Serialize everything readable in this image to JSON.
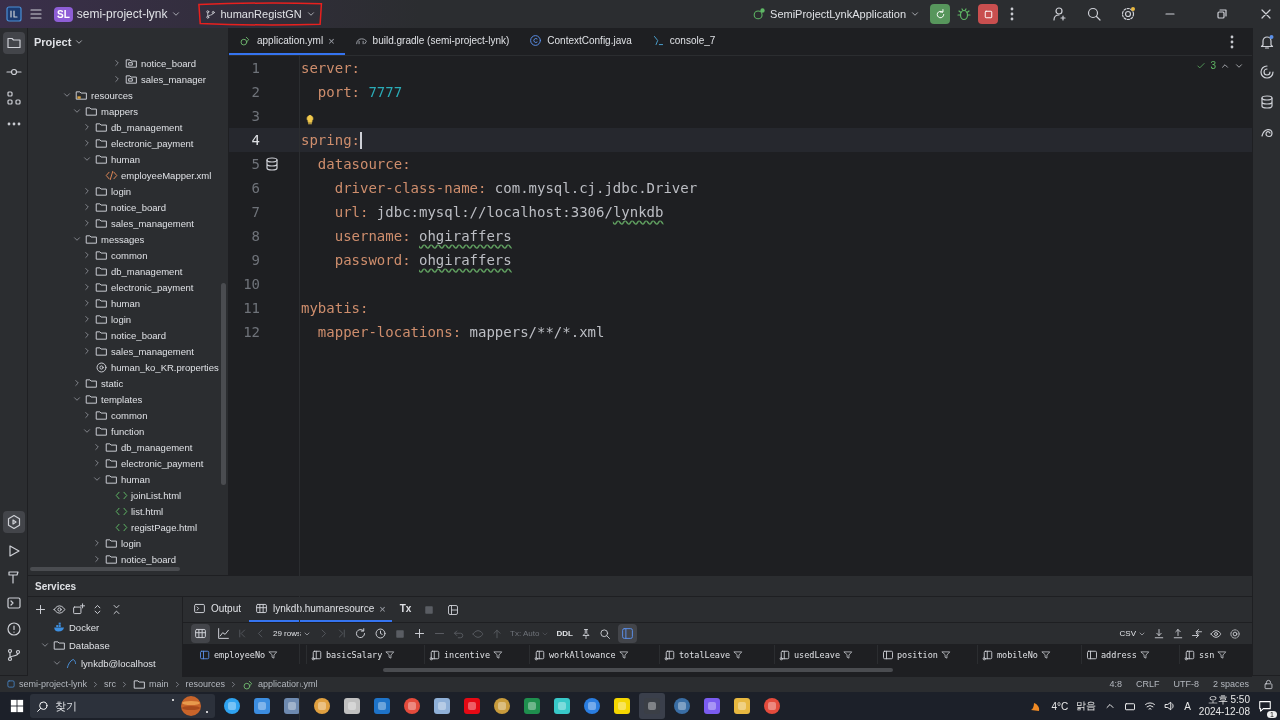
{
  "title_bar": {
    "project_badge": "SL",
    "project": "semi-project-lynk",
    "branch": "humanRegistGN",
    "run_config": "SemiProjectLynkApplication"
  },
  "project_panel": {
    "title": "Project",
    "tree_partial": [
      {
        "label": "notice_board",
        "kind": "package",
        "expanded": false
      },
      {
        "label": "sales_manager",
        "kind": "package",
        "expanded": false
      }
    ],
    "tree": [
      {
        "label": "resources",
        "kind": "resource-root",
        "expanded": true,
        "children": [
          {
            "label": "mappers",
            "kind": "folder",
            "expanded": true,
            "children": [
              {
                "label": "db_management",
                "kind": "folder",
                "expanded": false
              },
              {
                "label": "electronic_payment",
                "kind": "folder",
                "expanded": false
              },
              {
                "label": "human",
                "kind": "folder",
                "expanded": true,
                "children": [
                  {
                    "label": "employeeMapper.xml",
                    "kind": "xml"
                  }
                ]
              },
              {
                "label": "login",
                "kind": "folder",
                "expanded": false
              },
              {
                "label": "notice_board",
                "kind": "folder",
                "expanded": false
              },
              {
                "label": "sales_management",
                "kind": "folder",
                "expanded": false
              }
            ]
          },
          {
            "label": "messages",
            "kind": "folder",
            "expanded": true,
            "children": [
              {
                "label": "common",
                "kind": "folder",
                "expanded": false
              },
              {
                "label": "db_management",
                "kind": "folder",
                "expanded": false
              },
              {
                "label": "electronic_payment",
                "kind": "folder",
                "expanded": false
              },
              {
                "label": "human",
                "kind": "folder",
                "expanded": false
              },
              {
                "label": "login",
                "kind": "folder",
                "expanded": false
              },
              {
                "label": "notice_board",
                "kind": "folder",
                "expanded": false
              },
              {
                "label": "sales_management",
                "kind": "folder",
                "expanded": false
              },
              {
                "label": "human_ko_KR.properties",
                "kind": "properties"
              }
            ]
          },
          {
            "label": "static",
            "kind": "folder",
            "expanded": false
          },
          {
            "label": "templates",
            "kind": "folder",
            "expanded": true,
            "children": [
              {
                "label": "common",
                "kind": "folder",
                "expanded": false
              },
              {
                "label": "function",
                "kind": "folder",
                "expanded": true,
                "children": [
                  {
                    "label": "db_management",
                    "kind": "folder",
                    "expanded": false
                  },
                  {
                    "label": "electronic_payment",
                    "kind": "folder",
                    "expanded": false
                  },
                  {
                    "label": "human",
                    "kind": "folder",
                    "expanded": true,
                    "children": [
                      {
                        "label": "joinList.html",
                        "kind": "html"
                      },
                      {
                        "label": "list.html",
                        "kind": "html"
                      },
                      {
                        "label": "registPage.html",
                        "kind": "html"
                      }
                    ]
                  },
                  {
                    "label": "login",
                    "kind": "folder",
                    "expanded": false
                  },
                  {
                    "label": "notice_board",
                    "kind": "folder",
                    "expanded": false
                  }
                ]
              }
            ]
          }
        ]
      }
    ]
  },
  "editor": {
    "tabs": [
      {
        "label": "application.yml",
        "kind": "yaml",
        "selected": true,
        "close": "×"
      },
      {
        "label": "build.gradle (semi-project-lynk)",
        "kind": "gradle",
        "selected": false
      },
      {
        "label": "ContextConfig.java",
        "kind": "java",
        "selected": false
      },
      {
        "label": "console_7",
        "kind": "console",
        "selected": false
      }
    ],
    "inspection_count": "3",
    "lines": [
      {
        "number": "1",
        "kind": "plain",
        "current": false,
        "segments": [
          {
            "text": "server:",
            "kind": "key"
          }
        ]
      },
      {
        "number": "2",
        "kind": "plain",
        "current": false,
        "segments": [
          {
            "text": "  port:",
            "kind": "key"
          },
          {
            "text": " 7777",
            "kind": "number"
          }
        ]
      },
      {
        "number": "3",
        "kind": "hint",
        "current": false
      },
      {
        "number": "4",
        "kind": "plain",
        "current": true,
        "segments": [
          {
            "text": "spring:",
            "kind": "key"
          }
        ]
      },
      {
        "number": "5",
        "kind": "datasource",
        "current": false,
        "segments": [
          {
            "text": "  datasource:",
            "kind": "key"
          }
        ]
      },
      {
        "number": "6",
        "kind": "plain",
        "current": false,
        "segments": [
          {
            "text": "    driver-class-name:",
            "kind": "key"
          },
          {
            "text": " com.mysql.cj.jdbc.Driver",
            "kind": "value"
          }
        ]
      },
      {
        "number": "7",
        "kind": "plain",
        "current": false,
        "segments": [
          {
            "text": "    url:",
            "kind": "key"
          },
          {
            "text": " jdbc:mysql://localhost:3306/",
            "kind": "value"
          },
          {
            "text": "lynkdb",
            "kind": "typo"
          }
        ]
      },
      {
        "number": "8",
        "kind": "plain",
        "current": false,
        "segments": [
          {
            "text": "    username: ",
            "kind": "key"
          },
          {
            "text": "ohgiraffers",
            "kind": "typo"
          }
        ]
      },
      {
        "number": "9",
        "kind": "plain",
        "current": false,
        "segments": [
          {
            "text": "    password: ",
            "kind": "key"
          },
          {
            "text": "ohgiraffers",
            "kind": "typo"
          }
        ]
      },
      {
        "number": "10",
        "kind": "plain",
        "current": false
      },
      {
        "number": "11",
        "kind": "plain",
        "current": false,
        "segments": [
          {
            "text": "mybatis:",
            "kind": "key"
          }
        ]
      },
      {
        "number": "12",
        "kind": "plain",
        "current": false,
        "segments": [
          {
            "text": "  mapper-locations:",
            "kind": "key"
          },
          {
            "text": " mappers/**/*.xml",
            "kind": "value"
          }
        ]
      }
    ]
  },
  "services": {
    "title": "Services",
    "tree": [
      {
        "label": "Docker",
        "kind": "docker"
      },
      {
        "label": "Database",
        "kind": "folder",
        "expanded": true,
        "children": [
          {
            "label": "lynkdb@localhost",
            "kind": "datasource",
            "expanded": true
          }
        ]
      }
    ],
    "tabs": [
      {
        "label": "Output",
        "kind": "output",
        "selected": false
      },
      {
        "label": "lynkdb.humanresource",
        "kind": "table",
        "selected": true,
        "close": "×"
      }
    ],
    "tx_label": "Tx",
    "rows_label": "29 rows",
    "tx_mode": "Tx: Auto",
    "ddl": "DDL",
    "export_format": "CSV",
    "columns": [
      {
        "name": "employeeNo",
        "kind": "key"
      },
      {
        "name": "basicSalary",
        "kind": "column"
      },
      {
        "name": "incentive",
        "kind": "column"
      },
      {
        "name": "workAllowance",
        "kind": "column"
      },
      {
        "name": "totalLeave",
        "kind": "column"
      },
      {
        "name": "usedLeave",
        "kind": "column"
      },
      {
        "name": "position",
        "kind": "plain"
      },
      {
        "name": "mobileNo",
        "kind": "column"
      },
      {
        "name": "address",
        "kind": "plain"
      },
      {
        "name": "ssn",
        "kind": "column"
      }
    ]
  },
  "status_bar": {
    "breadcrumbs": [
      {
        "label": "semi-project-lynk",
        "kind": "module"
      },
      {
        "label": "src",
        "kind": "plain"
      },
      {
        "label": "main",
        "kind": "folder"
      },
      {
        "label": "resources",
        "kind": "plain"
      },
      {
        "label": "application.yml",
        "kind": "yaml"
      }
    ],
    "items": [
      "4:8",
      "CRLF",
      "UTF-8",
      "2 spaces"
    ]
  },
  "taskbar": {
    "search_placeholder": "찾기",
    "temperature": "4°C",
    "weather": "맑음",
    "ime": "A",
    "time": "오후 5:50",
    "date": "2024-12-08",
    "notification_count": "1"
  }
}
